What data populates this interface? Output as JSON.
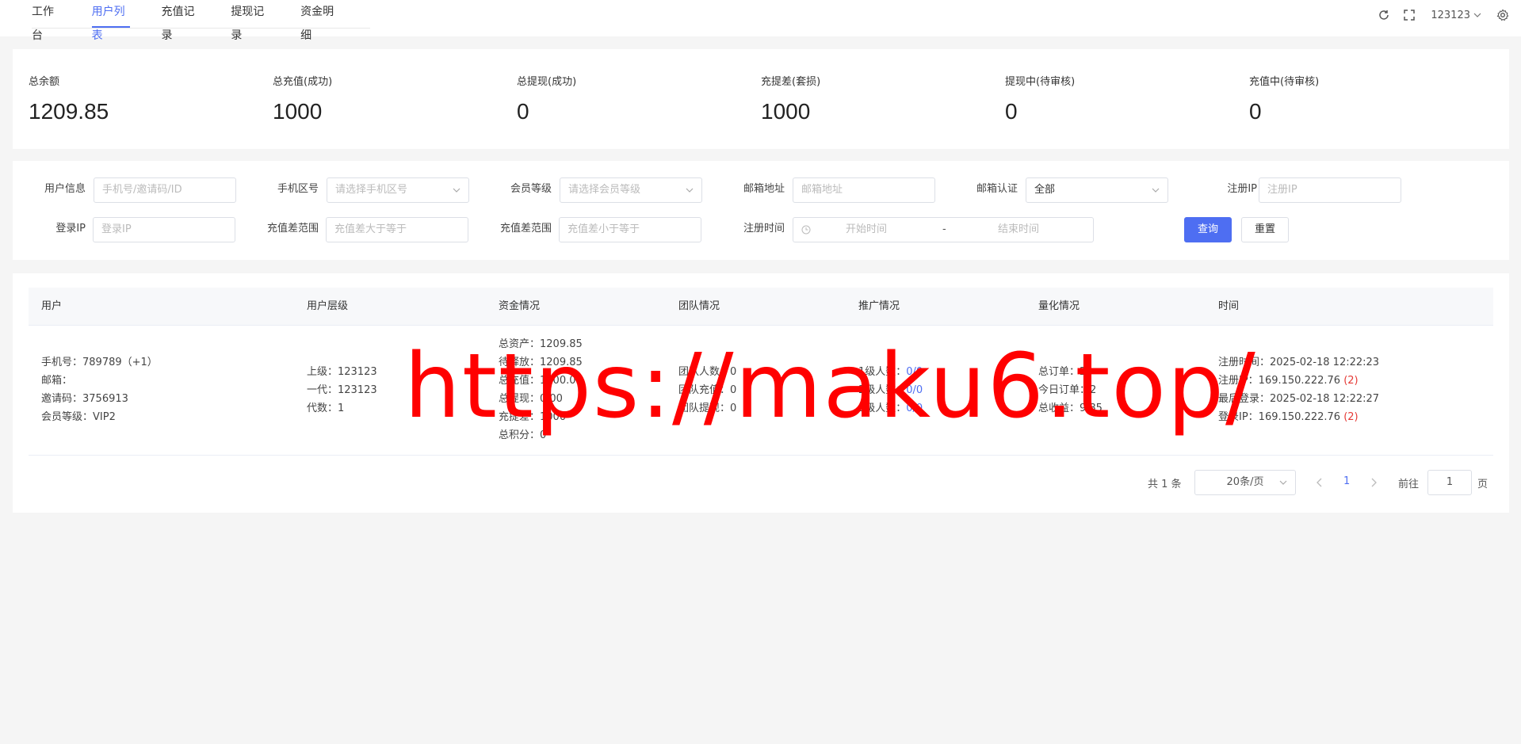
{
  "tabs": [
    "工作台",
    "用户列表",
    "充值记录",
    "提现记录",
    "资金明细"
  ],
  "active_tab": 1,
  "user": {
    "name": "123123"
  },
  "stats": [
    {
      "label": "总余额",
      "value": "1209.85"
    },
    {
      "label": "总充值(成功)",
      "value": "1000"
    },
    {
      "label": "总提现(成功)",
      "value": "0"
    },
    {
      "label": "充提差(套损)",
      "value": "1000"
    },
    {
      "label": "提现中(待审核)",
      "value": "0"
    },
    {
      "label": "充值中(待审核)",
      "value": "0"
    }
  ],
  "filter": {
    "user_info": {
      "label": "用户信息",
      "placeholder": "手机号/邀请码/ID"
    },
    "phone_area": {
      "label": "手机区号",
      "placeholder": "请选择手机区号"
    },
    "member_level": {
      "label": "会员等级",
      "placeholder": "请选择会员等级"
    },
    "email": {
      "label": "邮箱地址",
      "placeholder": "邮箱地址"
    },
    "email_verify": {
      "label": "邮箱认证",
      "value": "全部"
    },
    "register_ip": {
      "label": "注册IP",
      "placeholder": "注册IP"
    },
    "login_ip": {
      "label": "登录IP",
      "placeholder": "登录IP"
    },
    "diff_min": {
      "label": "充值差范围",
      "placeholder": "充值差大于等于"
    },
    "diff_max": {
      "label": "充值差范围",
      "placeholder": "充值差小于等于"
    },
    "register_time": {
      "label": "注册时间",
      "start": "开始时间",
      "separator": "-",
      "end": "结束时间"
    },
    "query_label": "查询",
    "reset_label": "重置"
  },
  "table": {
    "headers": [
      "用户",
      "用户层级",
      "资金情况",
      "团队情况",
      "推广情况",
      "量化情况",
      "时间"
    ],
    "row": {
      "user": [
        "手机号：789789（+1）",
        "邮箱：",
        "邀请码：3756913",
        "会员等级：VIP2"
      ],
      "level": [
        "上级：123123",
        "一代：123123",
        "代数：1"
      ],
      "funds": [
        "总资产：1209.85",
        "待释放：1209.85",
        "总充值：1000.00",
        "总提现：0.00",
        "充提差：1000",
        "总积分：0"
      ],
      "team": [
        "团队人数：0",
        "团队充值：0",
        "团队提现：0"
      ],
      "promo": [
        {
          "label": "1级人数：",
          "value": "0/0"
        },
        {
          "label": "2级人数：",
          "value": "0/0"
        },
        {
          "label": "3级人数：",
          "value": "0/0"
        }
      ],
      "quant": [
        "总订单：2",
        "今日订单：2",
        "总收益：9.85"
      ],
      "time": [
        {
          "text": "注册时间：2025-02-18 12:22:23",
          "badge": ""
        },
        {
          "text": "注册IP：169.150.222.76",
          "badge": "(2)"
        },
        {
          "text": "最后登录：2025-02-18 12:22:27",
          "badge": ""
        },
        {
          "text": "登录IP：169.150.222.76",
          "badge": "(2)"
        }
      ]
    }
  },
  "pagination": {
    "total": "共 1 条",
    "page_size": "20条/页",
    "current": "1",
    "goto_label": "前往",
    "goto_value": "1",
    "page_suffix": "页"
  },
  "watermark": "https://maku6.top/",
  "colors": {
    "accent": "#4e6ef2",
    "danger": "#e53935",
    "watermark": "#ff0000"
  }
}
